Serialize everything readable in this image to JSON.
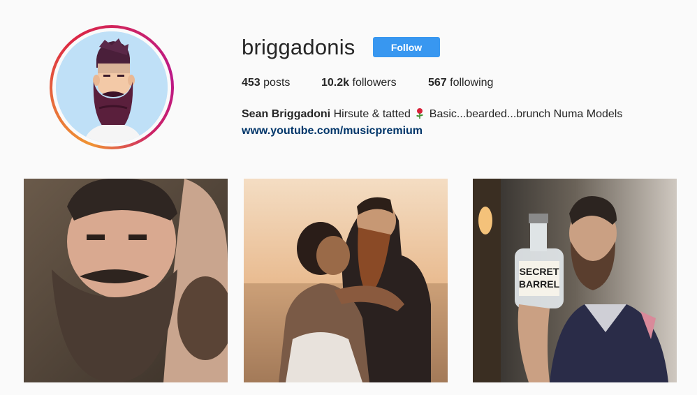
{
  "profile": {
    "username": "briggadonis",
    "follow_label": "Follow",
    "stats": {
      "posts_count": "453",
      "posts_label": "posts",
      "followers_count": "10.2k",
      "followers_label": "followers",
      "following_count": "567",
      "following_label": "following"
    },
    "bio": {
      "name": "Sean Briggadoni",
      "text_before_emoji": "Hirsute & tatted",
      "emoji": "rose-icon",
      "text_after_emoji": "Basic...bearded...brunch Numa Models"
    },
    "website": "www.youtube.com/musicpremium"
  },
  "posts": [
    {
      "subject": "bearded man selfie lying down"
    },
    {
      "subject": "couple embracing at sunset"
    },
    {
      "subject": "bearded man holding bottle",
      "bottle_text": [
        "SECRET",
        "BARREL"
      ]
    }
  ],
  "colors": {
    "follow_button": "#3897f0",
    "link": "#003569",
    "avatar_bg": "#bfe0f7"
  }
}
